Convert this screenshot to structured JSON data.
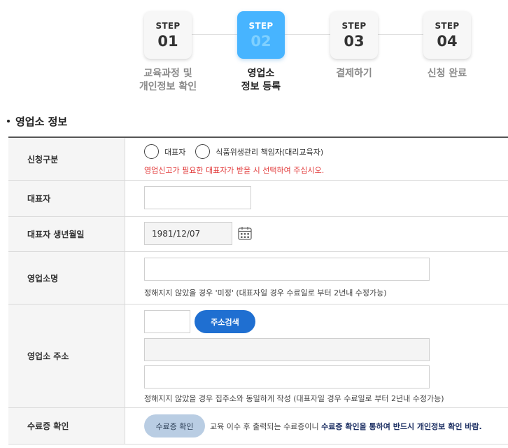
{
  "stepper": {
    "steps": [
      {
        "label": "STEP",
        "number": "01",
        "title_line1": "교육과정 및",
        "title_line2": "개인정보 확인",
        "active": false
      },
      {
        "label": "STEP",
        "number": "02",
        "title_line1": "영업소",
        "title_line2": "정보 등록",
        "active": true
      },
      {
        "label": "STEP",
        "number": "03",
        "title_line1": "결제하기",
        "title_line2": "",
        "active": false
      },
      {
        "label": "STEP",
        "number": "04",
        "title_line1": "신청 완료",
        "title_line2": "",
        "active": false
      }
    ]
  },
  "section": {
    "title": "영업소 정보"
  },
  "form": {
    "apply_type": {
      "label": "신청구분",
      "option1": "대표자",
      "option2": "식품위생관리 책임자(대리교육자)",
      "warning": "영업신고가 필요한 대표자가 받을 시 선택하여 주십시오."
    },
    "representative": {
      "label": "대표자",
      "value": ""
    },
    "birth": {
      "label": "대표자 생년월일",
      "value": "1981/12/07"
    },
    "business_name": {
      "label": "영업소명",
      "value": "",
      "hint": "정해지지 않았을 경우 '미정' (대표자일 경우 수료일로 부터 2년내 수정가능)"
    },
    "address": {
      "label": "영업소 주소",
      "zipcode": "",
      "search_button": "주소검색",
      "address1": "",
      "address2": "",
      "hint": "정해지지 않았을 경우 집주소와 동일하게 작성 (대표자일 경우 수료일로 부터 2년내 수정가능)"
    },
    "certificate": {
      "label": "수료증 확인",
      "button": "수료증 확인",
      "text_plain": "교육 이수 후 출력되는 수료증이니 ",
      "text_bold": "수료증 확인을 통하여 반드시 개인정보 확인 바람."
    }
  },
  "colors": {
    "accent": "#47b4ff",
    "primary_button": "#1f6fd1",
    "warning": "#e23b3b",
    "bold_text": "#1c2f63"
  }
}
